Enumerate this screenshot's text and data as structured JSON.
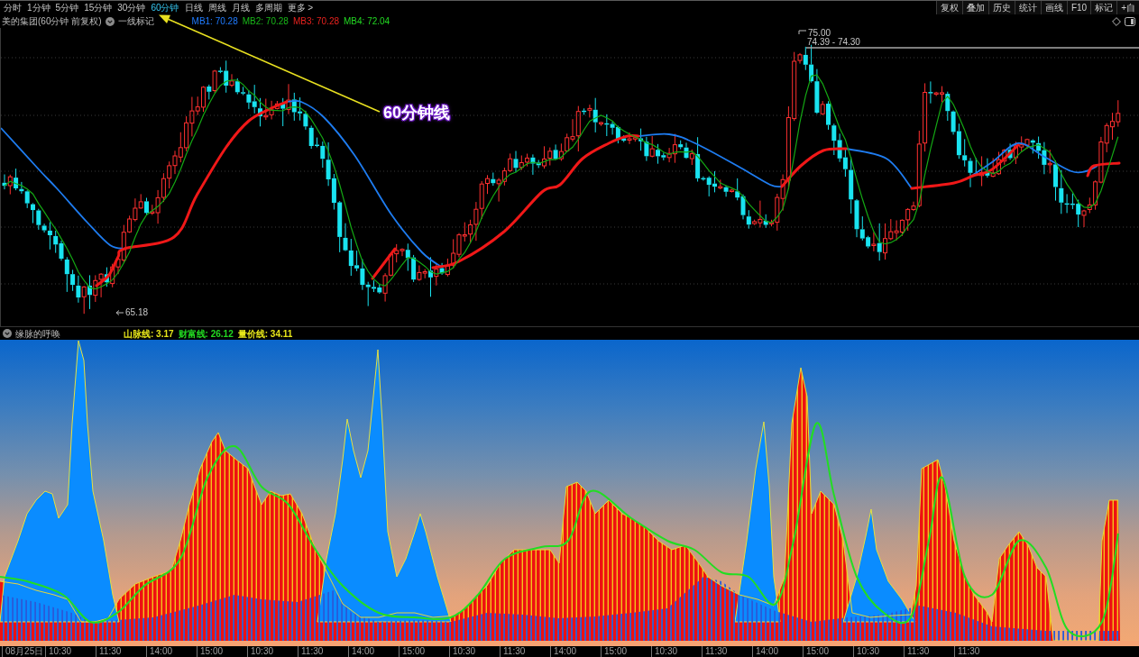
{
  "toolbar": {
    "periods": [
      {
        "label": "分时",
        "selected": false
      },
      {
        "label": "1分钟",
        "selected": false
      },
      {
        "label": "5分钟",
        "selected": false
      },
      {
        "label": "15分钟",
        "selected": false
      },
      {
        "label": "30分钟",
        "selected": false
      },
      {
        "label": "60分钟",
        "selected": true
      },
      {
        "label": "日线",
        "selected": false
      },
      {
        "label": "周线",
        "selected": false
      },
      {
        "label": "月线",
        "selected": false
      },
      {
        "label": "多周期",
        "selected": false
      },
      {
        "label": "更多 >",
        "selected": false
      }
    ],
    "tools": [
      "复权",
      "叠加",
      "历史",
      "统计",
      "画线",
      "F10",
      "标记",
      "+自"
    ]
  },
  "chart_header": {
    "title": "美的集团(60分钟 前复权)",
    "marker_label": "一线标记",
    "indicators": [
      {
        "text": "MB1: 70.28",
        "color": "#1f7bff"
      },
      {
        "text": "MB2: 70.28",
        "color": "#18b818"
      },
      {
        "text": "MB3: 70.28",
        "color": "#e8221e"
      },
      {
        "text": "MB4: 72.04",
        "color": "#22d822"
      }
    ]
  },
  "price_chart": {
    "high_label": "75.00",
    "range_label": "74.39 - 74.30",
    "low_label": "65.18",
    "annotation": "60分钟线"
  },
  "indicator_panel": {
    "name": "缘脉的呼唤",
    "values": [
      {
        "text": "山脉线: 3.17",
        "color": "#e6e61a"
      },
      {
        "text": "财富线: 26.12",
        "color": "#22d822"
      },
      {
        "text": "量价线: 34.11",
        "color": "#e6e61a"
      }
    ]
  },
  "time_axis": [
    "08月25日",
    "10:30",
    "11:30",
    "14:00",
    "15:00",
    "10:30",
    "11:30",
    "14:00",
    "15:00",
    "10:30",
    "11:30",
    "14:00",
    "15:00",
    "10:30",
    "11:30",
    "14:00",
    "15:00",
    "10:30",
    "11:30",
    "11:30"
  ]
}
